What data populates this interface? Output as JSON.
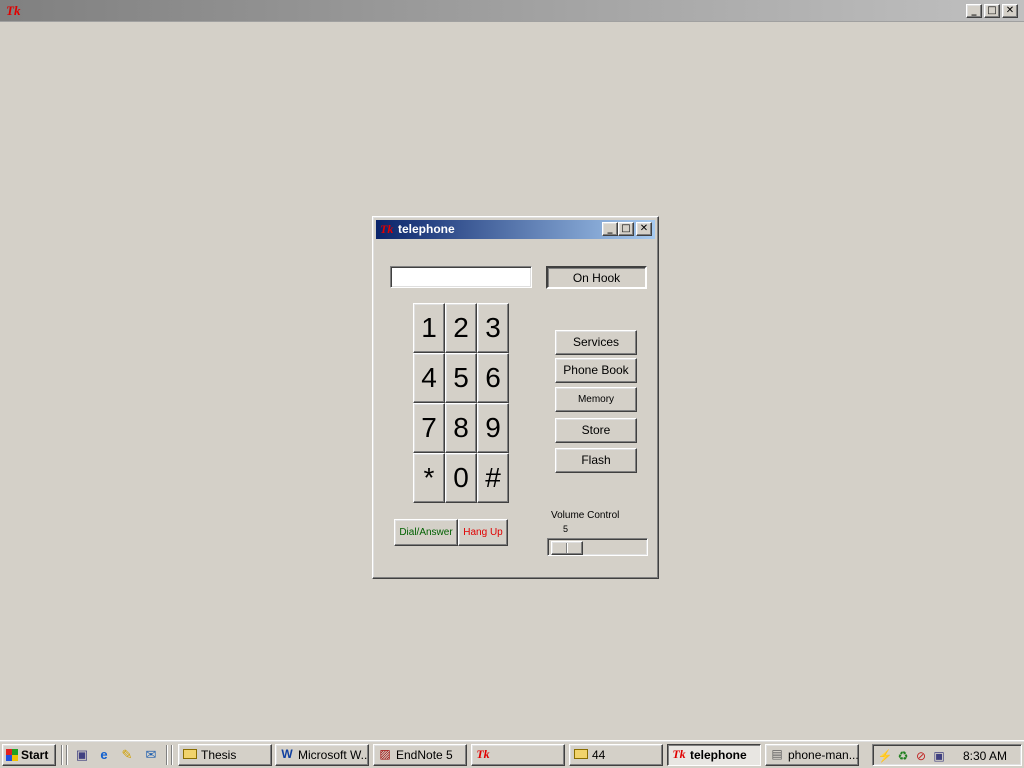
{
  "background_window": {
    "logo": "Tk",
    "buttons": [
      "minimize-icon",
      "maximize-icon",
      "close-icon"
    ]
  },
  "telephone": {
    "title": "telephone",
    "logo": "Tk",
    "display_value": "",
    "hook_status": "On Hook",
    "keypad": [
      "1",
      "2",
      "3",
      "4",
      "5",
      "6",
      "7",
      "8",
      "9",
      "*",
      "0",
      "#"
    ],
    "buttons": {
      "services": "Services",
      "phone_book": "Phone Book",
      "memory": "Memory",
      "store": "Store",
      "flash": "Flash",
      "dial": "Dial/Answer",
      "hangup": "Hang Up"
    },
    "volume": {
      "label": "Volume Control",
      "value": "5"
    },
    "colors": {
      "dial": "#006000",
      "hangup": "#e00000",
      "title_start": "#0a246a",
      "title_end": "#a6caf0"
    }
  },
  "taskbar": {
    "start": "Start",
    "quick_launch": [
      "show-desktop-icon",
      "ie-icon",
      "pencil-icon",
      "outlook-icon"
    ],
    "tasks": [
      {
        "label": "Thesis",
        "icon": "folder-icon"
      },
      {
        "label": "Microsoft W...",
        "icon": "word-icon"
      },
      {
        "label": "EndNote 5",
        "icon": "endnote-icon"
      },
      {
        "label": "",
        "icon": "tk-icon"
      },
      {
        "label": "44",
        "icon": "folder-icon"
      },
      {
        "label": "telephone",
        "icon": "tk-icon",
        "active": true
      },
      {
        "label": "phone-man...",
        "icon": "document-icon"
      }
    ],
    "tray_icons": [
      "network-icon",
      "antivirus-icon",
      "volume-icon",
      "connection-icon"
    ],
    "clock": "8:30 AM"
  }
}
